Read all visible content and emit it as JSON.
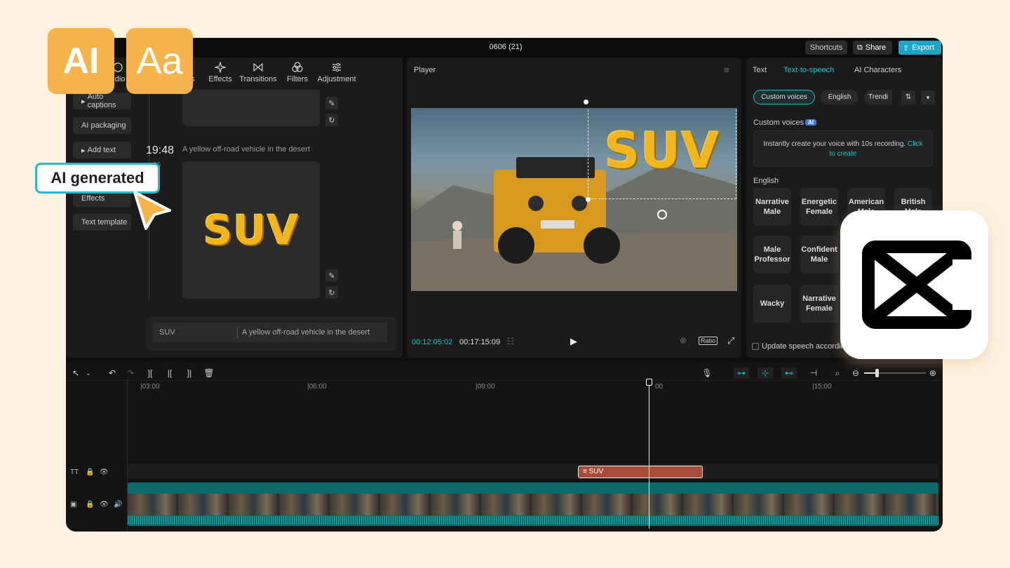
{
  "window": {
    "title": "0606 (21)",
    "shortcuts_label": "Shortcuts",
    "share_label": "Share",
    "export_label": "Export",
    "hidden_left_text": "o s"
  },
  "top_tabs": [
    {
      "label": "udio"
    },
    {
      "label": "rs"
    },
    {
      "label": "Effects"
    },
    {
      "label": "Transitions"
    },
    {
      "label": "Filters"
    },
    {
      "label": "Adjustment"
    }
  ],
  "left_sidebar": [
    "Auto captions",
    "AI packaging",
    "Add text",
    "Effects",
    "Text template"
  ],
  "generation": {
    "time": "19:48",
    "date_fragment": "06",
    "prompt": "A yellow off-road vehicle in the desert",
    "result_text": "SUV"
  },
  "prompt_bar": {
    "keyword": "SUV",
    "description": "A yellow off-road vehicle in the desert"
  },
  "player": {
    "label": "Player",
    "overlay_text": "SUV",
    "current_time": "00:12:05:02",
    "total_time": "00:17:15:09",
    "ratio_label": "Ratio"
  },
  "right_tabs": [
    {
      "label": "Text"
    },
    {
      "label": "Text-to-speech"
    },
    {
      "label": "AI Characters"
    }
  ],
  "voice_filters": [
    "Custom voices",
    "English",
    "Trendi"
  ],
  "custom_voices": {
    "heading": "Custom voices",
    "badge": "AI",
    "desc": "Instantly create your voice with 10s recording.",
    "link": "Click to create"
  },
  "english_heading": "English",
  "voices": [
    "Narrative Male",
    "Energetic Female",
    "American Male",
    "British Male",
    "Male Professor",
    "Confident Male",
    "Wacky",
    "Narrative Female"
  ],
  "update_speech": "Update speech according",
  "timeline": {
    "ticks": [
      "03:00",
      "06:00",
      "09:00",
      "00",
      "15:00"
    ],
    "text_clip": "SUV",
    "playhead_fraction": 0.645
  },
  "overlays": {
    "ai_badge": "AI",
    "font_badge": "Aa",
    "ai_generated": "AI generated"
  },
  "colors": {
    "accent": "#19c4c9",
    "export_bg": "#1aa6c9",
    "text_clip": "#a84a3c",
    "video_track": "#0f6a6e",
    "badge_orange": "#f7b24a"
  }
}
